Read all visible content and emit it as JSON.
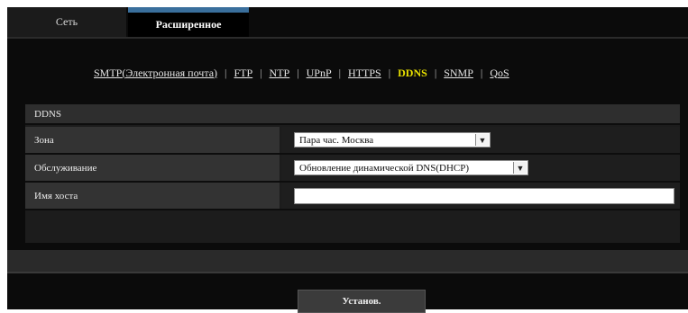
{
  "tabs": [
    {
      "label": "Сеть",
      "active": false
    },
    {
      "label": "Расширенное",
      "active": true
    }
  ],
  "links": [
    {
      "label": "SMTP(Электронная почта)",
      "current": false
    },
    {
      "label": "FTP",
      "current": false
    },
    {
      "label": "NTP",
      "current": false
    },
    {
      "label": "UPnP",
      "current": false
    },
    {
      "label": "HTTPS",
      "current": false
    },
    {
      "label": "DDNS",
      "current": true
    },
    {
      "label": "SNMP",
      "current": false
    },
    {
      "label": "QoS",
      "current": false
    }
  ],
  "link_separator": "|",
  "section": {
    "title": "DDNS",
    "rows": [
      {
        "label": "Зона",
        "type": "select",
        "value": "Пара час. Москва"
      },
      {
        "label": "Обслуживание",
        "type": "select",
        "value": "Обновление динамической DNS(DHCP)"
      },
      {
        "label": "Имя хоста",
        "type": "text",
        "value": ""
      }
    ]
  },
  "buttons": {
    "set_label": "Установ."
  },
  "icons": {
    "select_caret": "chevron-down-icon"
  },
  "colors": {
    "accent_current_link": "#e8e000",
    "active_tab_stripe": "#3a6f9c",
    "background": "#0b0b0b"
  }
}
